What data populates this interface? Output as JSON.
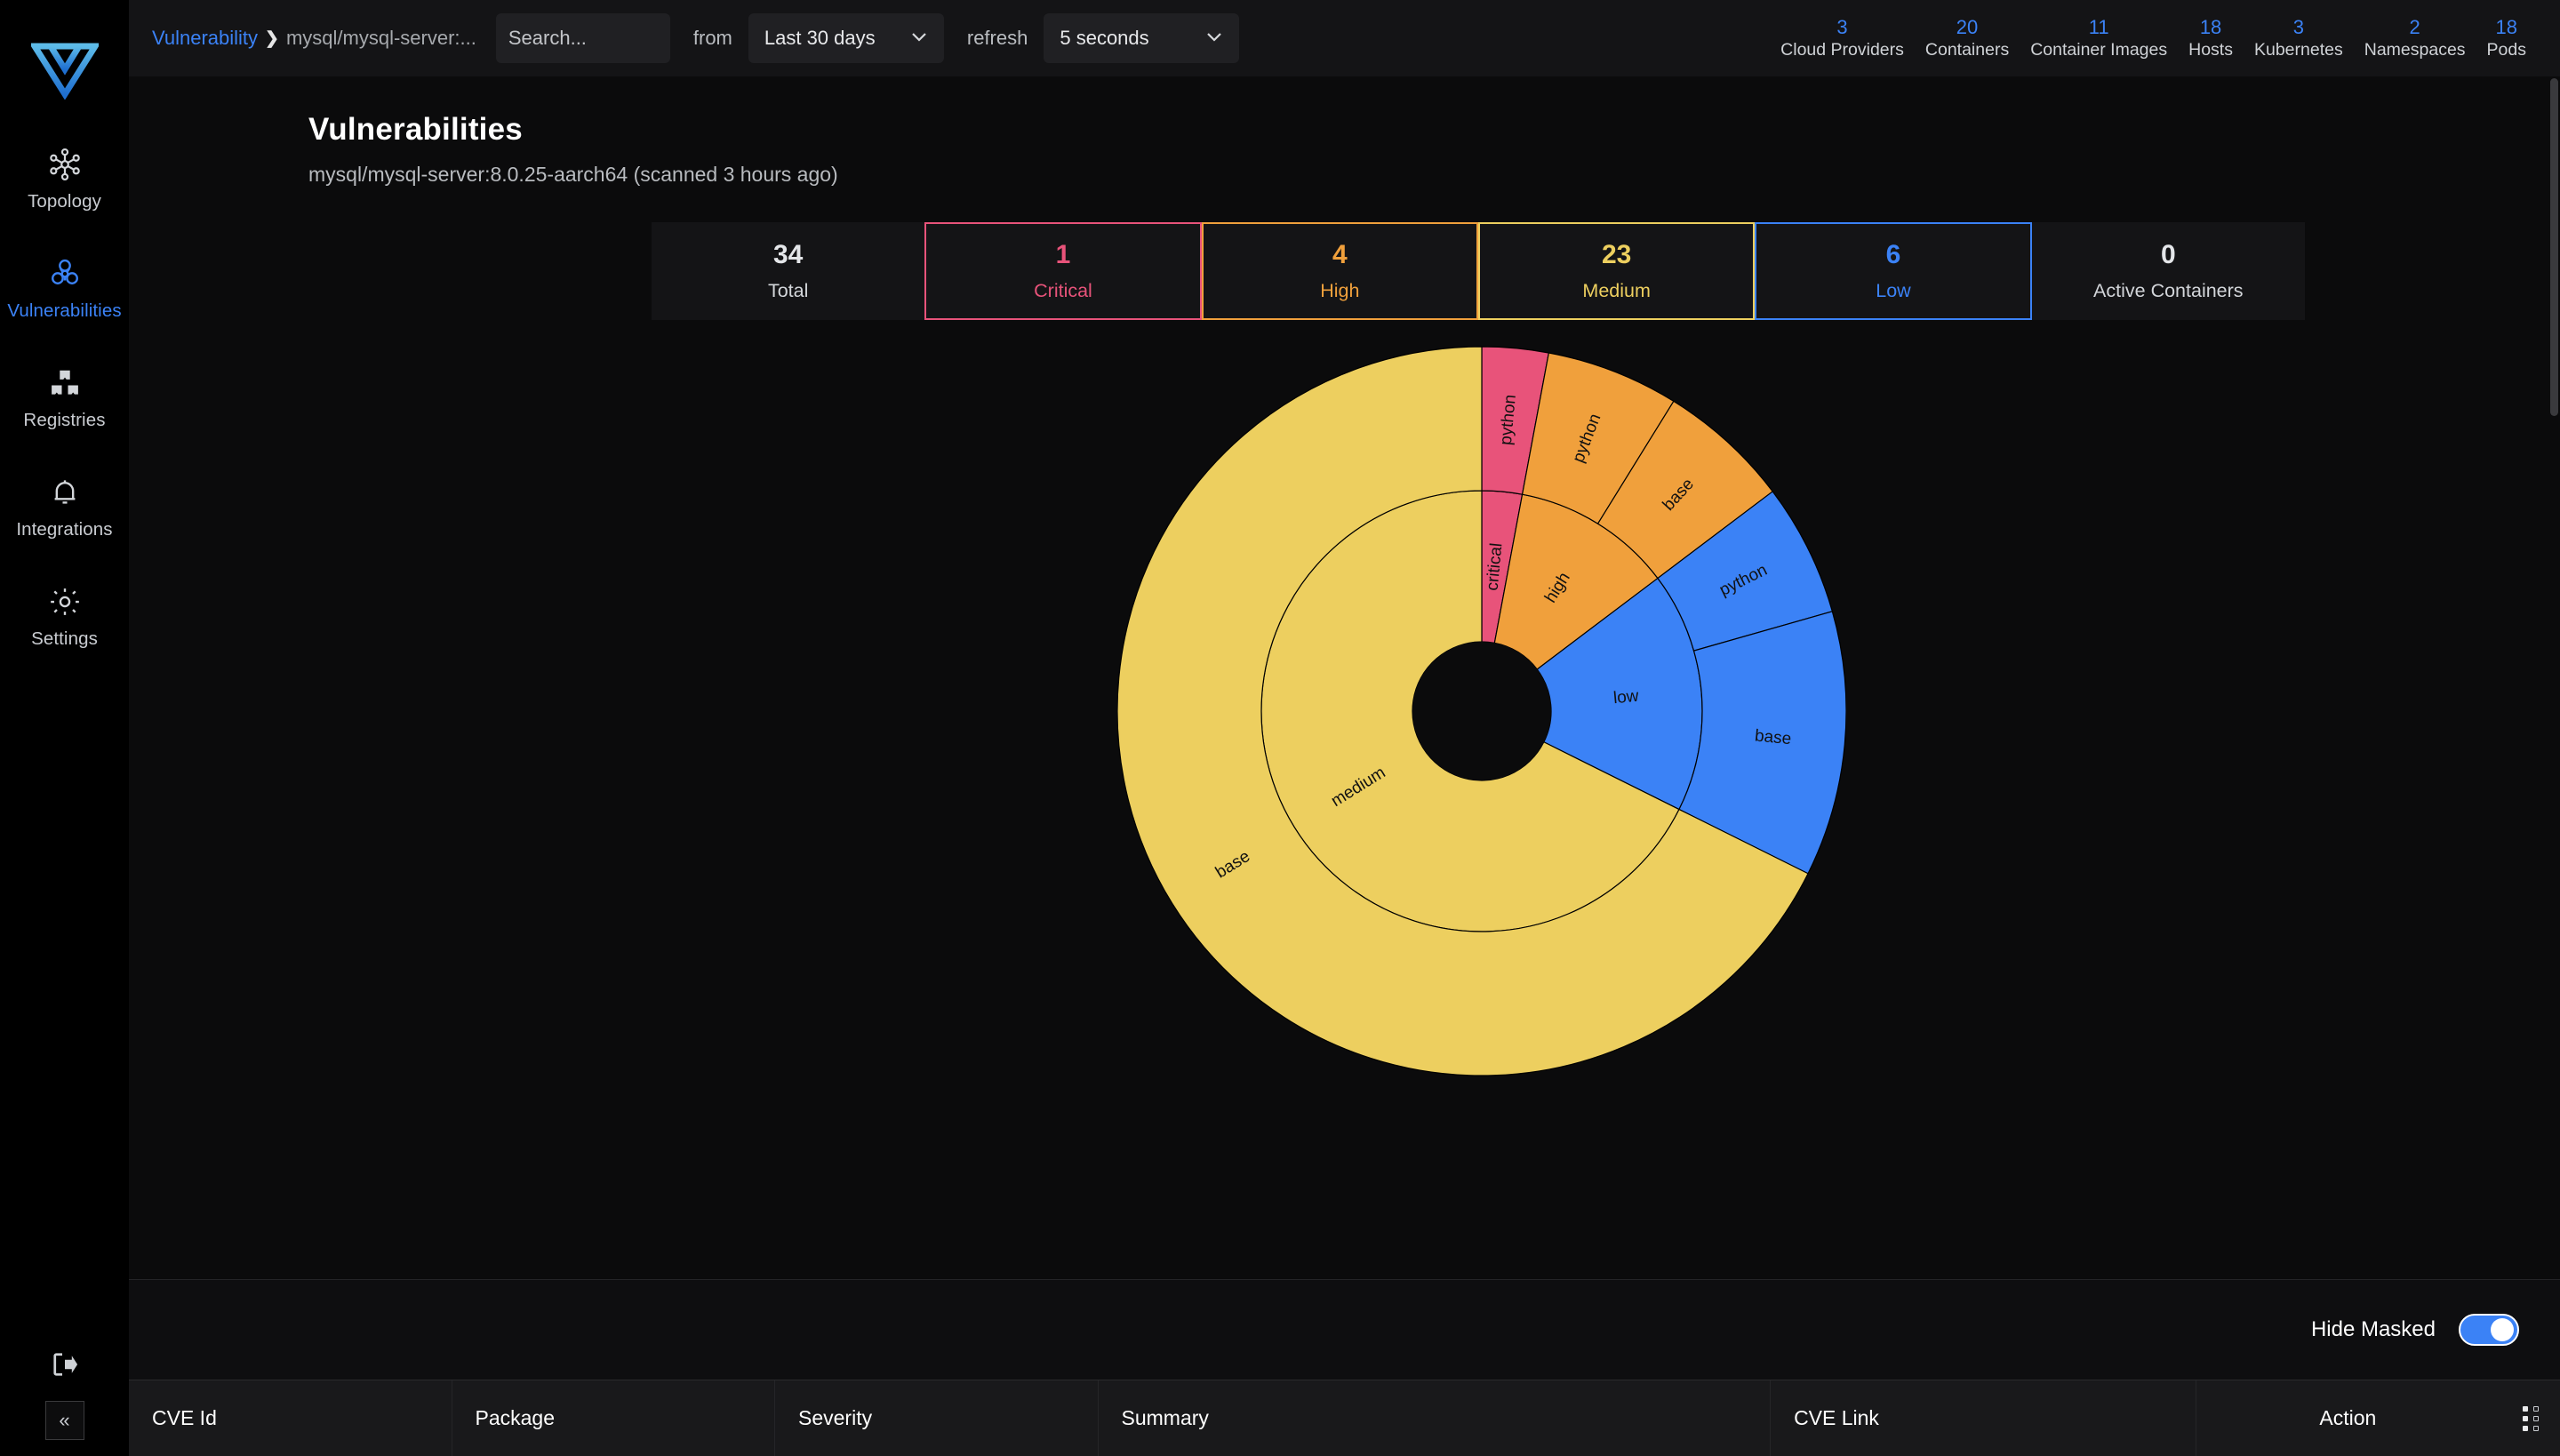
{
  "app": {
    "logo_icon": "deepfence-logo"
  },
  "sidebar": {
    "items": [
      {
        "label": "Topology",
        "icon": "topology-icon",
        "active": false
      },
      {
        "label": "Vulnerabilities",
        "icon": "biohazard-icon",
        "active": true
      },
      {
        "label": "Registries",
        "icon": "boxes-icon",
        "active": false
      },
      {
        "label": "Integrations",
        "icon": "bell-icon",
        "active": false
      },
      {
        "label": "Settings",
        "icon": "gear-icon",
        "active": false
      }
    ],
    "logout_icon": "logout-icon",
    "collapse_label": "«"
  },
  "topbar": {
    "breadcrumb_root": "Vulnerability",
    "breadcrumb_sep": "❯",
    "breadcrumb_current": "mysql/mysql-server:...",
    "search_placeholder": "Search...",
    "from_label": "from",
    "range_value": "Last 30 days",
    "refresh_label": "refresh",
    "refresh_value": "5 seconds",
    "chevron_icon": "chevron-down-icon",
    "stats": [
      {
        "value": "3",
        "label": "Cloud Providers"
      },
      {
        "value": "20",
        "label": "Containers"
      },
      {
        "value": "11",
        "label": "Container Images"
      },
      {
        "value": "18",
        "label": "Hosts"
      },
      {
        "value": "3",
        "label": "Kubernetes"
      },
      {
        "value": "2",
        "label": "Namespaces"
      },
      {
        "value": "18",
        "label": "Pods"
      }
    ]
  },
  "page": {
    "title": "Vulnerabilities",
    "subtitle": "mysql/mysql-server:8.0.25-aarch64 (scanned 3 hours ago)"
  },
  "severity_cards": [
    {
      "value": "34",
      "label": "Total",
      "color": "#e4e6e9",
      "border": "none"
    },
    {
      "value": "1",
      "label": "Critical",
      "color": "#e8537a",
      "border": "#e8537a"
    },
    {
      "value": "4",
      "label": "High",
      "color": "#f0a03c",
      "border": "#f0a03c"
    },
    {
      "value": "23",
      "label": "Medium",
      "color": "#edcf5f",
      "border": "#edcf5f"
    },
    {
      "value": "6",
      "label": "Low",
      "color": "#3b82f6",
      "border": "#3b82f6"
    },
    {
      "value": "0",
      "label": "Active Containers",
      "color": "#e4e6e9",
      "border": "none"
    }
  ],
  "chart_data": {
    "type": "pie",
    "variant": "sunburst",
    "title": "",
    "legend": "none",
    "total": 34,
    "colors": {
      "critical": "#e8537a",
      "high": "#f0a03c",
      "medium": "#edcf5f",
      "low": "#3b82f6",
      "center": "#0b0b0c",
      "stroke": "#000000"
    },
    "inner_ring": [
      {
        "label": "critical",
        "value": 1,
        "color": "#e8537a"
      },
      {
        "label": "high",
        "value": 4,
        "color": "#f0a03c"
      },
      {
        "label": "low",
        "value": 6,
        "color": "#3b82f6"
      },
      {
        "label": "medium",
        "value": 23,
        "color": "#edcf5f"
      }
    ],
    "outer_ring": [
      {
        "parent": "critical",
        "label": "python",
        "value": 1,
        "color": "#e8537a"
      },
      {
        "parent": "high",
        "label": "python",
        "value": 2,
        "color": "#f0a03c"
      },
      {
        "parent": "high",
        "label": "base",
        "value": 2,
        "color": "#f0a03c"
      },
      {
        "parent": "low",
        "label": "python",
        "value": 2,
        "color": "#3b82f6"
      },
      {
        "parent": "low",
        "label": "base",
        "value": 4,
        "color": "#3b82f6"
      },
      {
        "parent": "medium",
        "label": "base",
        "value": 23,
        "color": "#edcf5f"
      }
    ]
  },
  "table": {
    "hide_masked_label": "Hide Masked",
    "hide_masked_on": true,
    "columns": [
      "CVE Id",
      "Package",
      "Severity",
      "Summary",
      "CVE Link",
      "Action"
    ],
    "column_menu_icon": "column-settings-icon"
  }
}
